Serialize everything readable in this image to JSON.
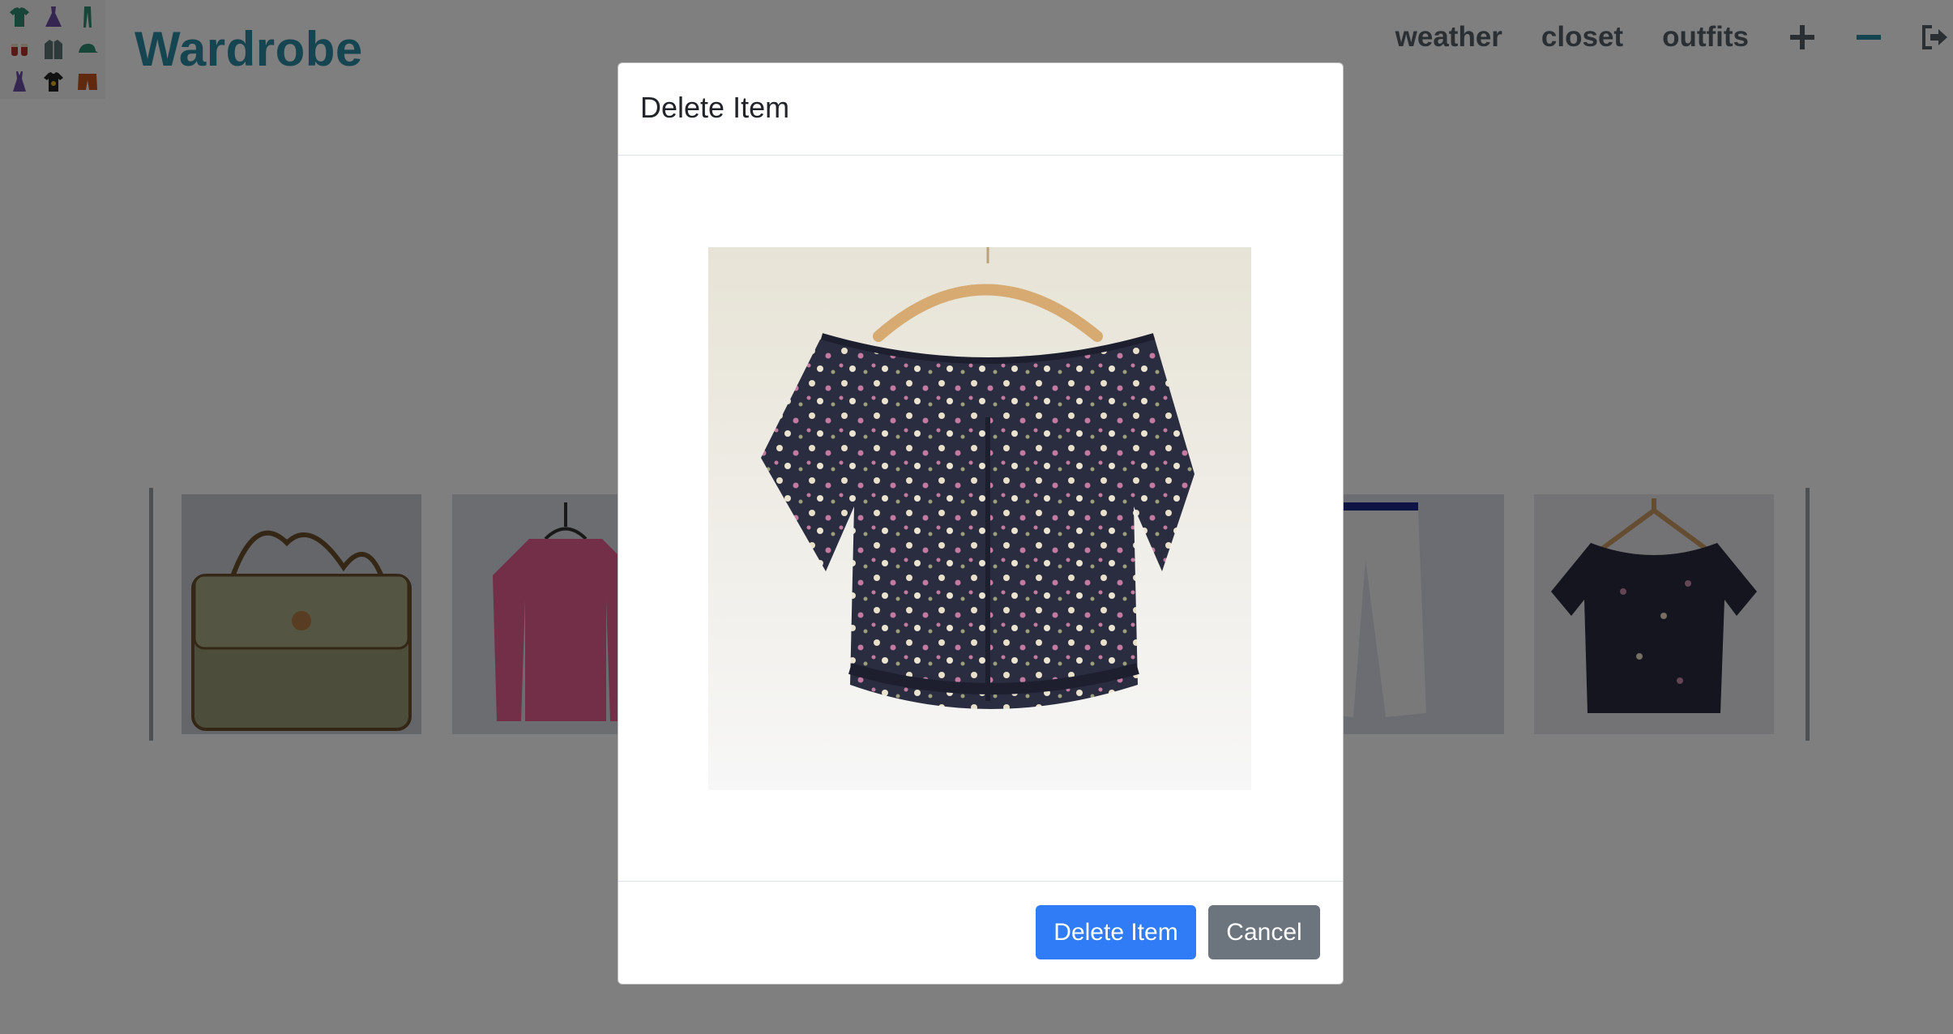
{
  "app": {
    "brand": "Wardrobe"
  },
  "nav": {
    "links": [
      "weather",
      "closet",
      "outfits"
    ],
    "icons": [
      "plus-icon",
      "minus-icon",
      "sign-out-icon"
    ]
  },
  "logo": {
    "icons": [
      "shirt-icon",
      "dress-icon",
      "pants-icon",
      "shoes-icon",
      "jacket-icon",
      "cap-icon",
      "dress-icon",
      "tshirt-icon",
      "shorts-icon"
    ],
    "colors": [
      "#2e8b6e",
      "#6a4ba3",
      "#2e8b6e",
      "#b5322a",
      "#5c7575",
      "#2e8b6e",
      "#6a4ba3",
      "#222222",
      "#c2541f"
    ]
  },
  "carousel": {
    "items": [
      "handbag",
      "pink-sweater",
      "white-pants",
      "floral-top"
    ]
  },
  "modal": {
    "title": "Delete Item",
    "image": "floral-top",
    "confirm_label": "Delete Item",
    "cancel_label": "Cancel"
  },
  "colors": {
    "brand": "#2a8aa3",
    "primary": "#2f7cf6",
    "secondary": "#6c757d",
    "nav_text": "#555e66"
  }
}
